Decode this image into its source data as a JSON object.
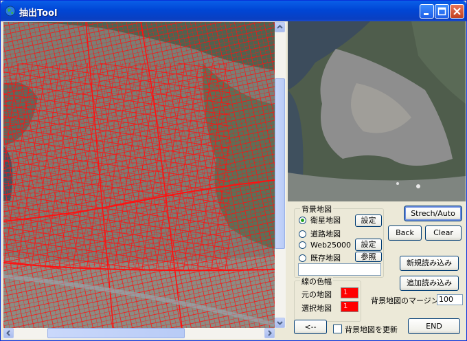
{
  "window": {
    "title": "抽出Tool"
  },
  "background_group": {
    "title": "背景地図",
    "options": [
      {
        "label": "衛星地図",
        "checked": true,
        "button": "設定"
      },
      {
        "label": "道路地図",
        "checked": false,
        "button": ""
      },
      {
        "label": "Web25000",
        "checked": false,
        "button": "設定"
      },
      {
        "label": "既存地図",
        "checked": false,
        "button": "参照"
      }
    ],
    "path_value": ""
  },
  "line_color_group": {
    "title": "線の色幅",
    "original_map_label": "元の地図",
    "original_map_width": "1",
    "selected_map_label": "選択地図",
    "selected_map_width": "1",
    "line_color": "#ff0000"
  },
  "buttons": {
    "stretch_auto": "Strech/Auto",
    "back": "Back",
    "clear": "Clear",
    "new_load": "新規読み込み",
    "add_load": "追加読み込み",
    "prev": "<--",
    "end": "END"
  },
  "margin": {
    "label": "背景地図のマージン",
    "value": "100"
  },
  "update_bg": {
    "label": "背景地図を更新",
    "checked": false
  },
  "icons": [
    "app-globe-icon",
    "minimize-icon",
    "maximize-icon",
    "close-icon",
    "scroll-up-arrow-icon",
    "scroll-down-arrow-icon",
    "scroll-left-arrow-icon",
    "scroll-right-arrow-icon"
  ]
}
